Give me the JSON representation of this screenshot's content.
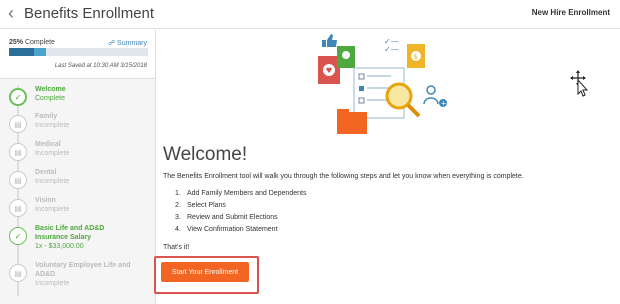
{
  "header": {
    "title": "Benefits Enrollment",
    "right_label": "New Hire Enrollment",
    "back_icon": "chevron-left-icon"
  },
  "progress": {
    "percent_label": "25%",
    "complete_word": "Complete",
    "summary_link": "Summary",
    "last_saved": "Last Saved at 10:30 AM 3/15/2018",
    "fraction": 0.25,
    "colors": {
      "track": "#e0e6eb",
      "fill": "#2a6e99",
      "segment": "#4ea3cc"
    }
  },
  "steps": [
    {
      "name": "Welcome",
      "status": "Complete",
      "state": "active"
    },
    {
      "name": "Family",
      "status": "Incomplete",
      "state": "pending"
    },
    {
      "name": "Medical",
      "status": "Incomplete",
      "state": "pending"
    },
    {
      "name": "Dental",
      "status": "Incomplete",
      "state": "pending"
    },
    {
      "name": "Vision",
      "status": "Incomplete",
      "state": "pending"
    },
    {
      "name": "Basic Life and AD&D",
      "name2": "Insurance Salary",
      "status": "1x - $33,000.00",
      "state": "done"
    },
    {
      "name": "Voluntary Employee Life and",
      "name2": "AD&D",
      "status": "Incomplete",
      "state": "pending"
    }
  ],
  "main": {
    "heading": "Welcome!",
    "intro": "The Benefits Enrollment tool will walk you through the following steps and let you know when everything is complete.",
    "list": [
      {
        "num": "1.",
        "text": "Add Family Members and Dependents"
      },
      {
        "num": "2.",
        "text": "Select Plans"
      },
      {
        "num": "3.",
        "text": "Review and Submit Elections"
      },
      {
        "num": "4.",
        "text": "View Confirmation Statement"
      }
    ],
    "closing": "That's it!",
    "button": "Start Your Enrollment",
    "button_color": "#f26522",
    "highlight_color": "#d9534f"
  }
}
